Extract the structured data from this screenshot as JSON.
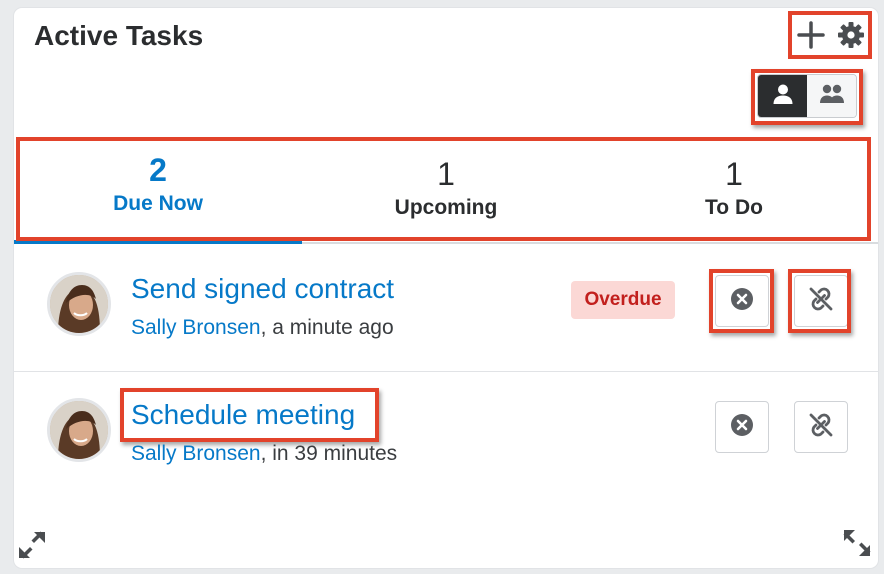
{
  "dashlet": {
    "title": "Active Tasks"
  },
  "header_actions": [
    {
      "icon": "plus-icon"
    },
    {
      "icon": "gear-icon"
    }
  ],
  "view_toggle": [
    {
      "icon": "single-user-icon",
      "selected": true
    },
    {
      "icon": "team-users-icon",
      "selected": false
    }
  ],
  "tabs": [
    {
      "count": "2",
      "label": "Due Now",
      "active": true
    },
    {
      "count": "1",
      "label": "Upcoming",
      "active": false
    },
    {
      "count": "1",
      "label": "To Do",
      "active": false
    }
  ],
  "tasks": [
    {
      "title": "Send signed contract",
      "user": "Sally Bronsen",
      "time": ", a minute ago",
      "badge": "Overdue",
      "actions": [
        "close-circle-icon",
        "unlink-icon"
      ]
    },
    {
      "title": "Schedule meeting",
      "user": "Sally Bronsen",
      "time": ", in 39 minutes",
      "actions": [
        "close-circle-icon",
        "unlink-icon"
      ]
    }
  ],
  "colors": {
    "accent": "#0679c8",
    "overdue_bg": "#fbd8d5",
    "overdue_text": "#c2201d",
    "highlight": "#e2432b"
  }
}
